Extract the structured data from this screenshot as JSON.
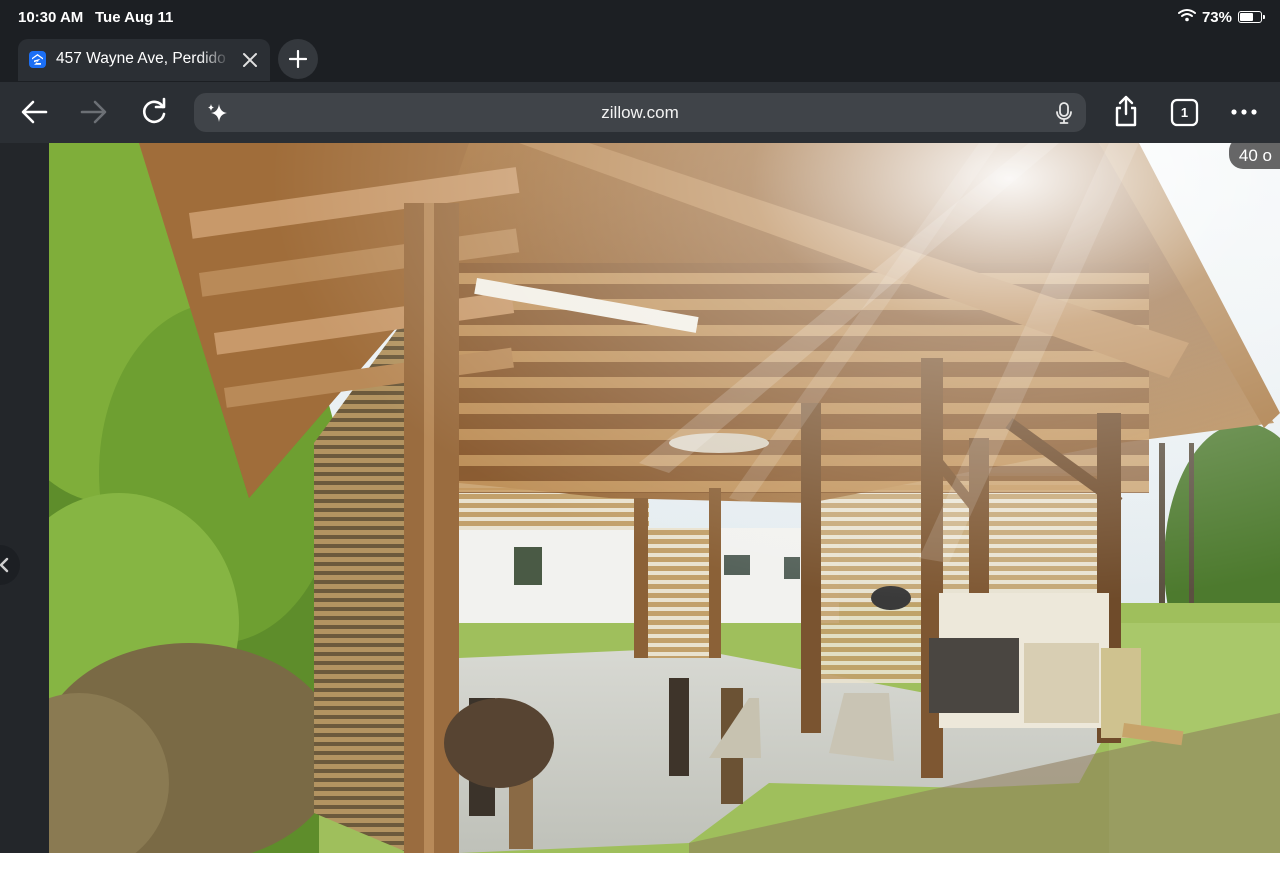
{
  "status_bar": {
    "time": "10:30 AM",
    "date": "Tue Aug 11",
    "battery_percent": "73%",
    "battery_level": 0.73,
    "icons": [
      "wifi-icon",
      "battery-icon"
    ]
  },
  "tabs": [
    {
      "title": "457 Wayne Ave, Perdido",
      "favicon": "zillow-logo-icon",
      "active": true
    }
  ],
  "toolbar": {
    "address": "zillow.com",
    "icons": [
      "back-arrow-icon",
      "forward-arrow-icon",
      "reload-icon",
      "sparkle-icon",
      "microphone-icon",
      "share-icon",
      "tab-count-icon",
      "more-options-icon"
    ],
    "tab_count": "1"
  },
  "photo": {
    "counter_text": "40 o",
    "description_icon": "property-photo"
  },
  "colors": {
    "chrome_dark": "#1c1f23",
    "toolbar": "#2b2f34",
    "address_bar": "#404449",
    "zillow_blue": "#1b6ff5"
  }
}
